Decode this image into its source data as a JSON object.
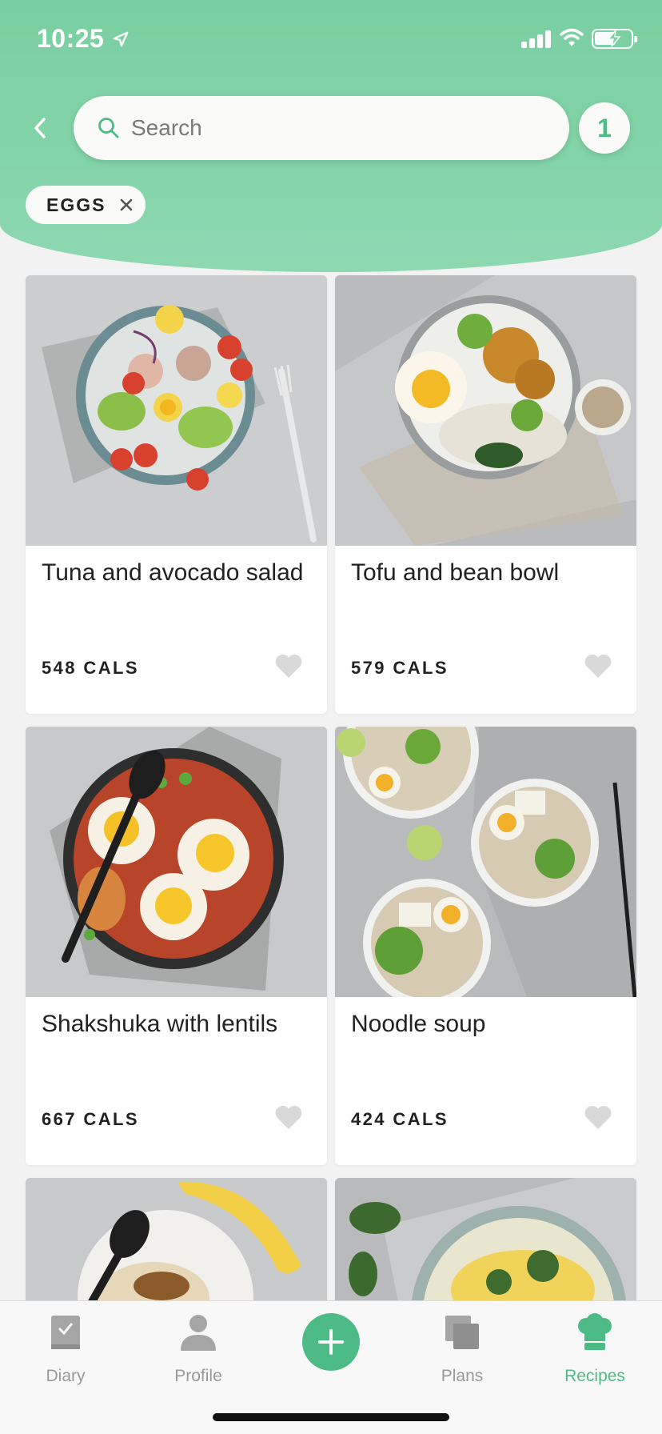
{
  "status": {
    "time": "10:25"
  },
  "search": {
    "placeholder": "Search",
    "value": ""
  },
  "filter_count": "1",
  "filters": [
    {
      "label": "EGGS"
    }
  ],
  "recipes": [
    {
      "title": "Tuna and avocado salad",
      "cals": "548 CALS"
    },
    {
      "title": "Tofu and bean bowl",
      "cals": "579 CALS"
    },
    {
      "title": "Shakshuka with lentils",
      "cals": "667 CALS"
    },
    {
      "title": "Noodle soup",
      "cals": "424 CALS"
    }
  ],
  "tabs": [
    {
      "label": "Diary",
      "icon": "diary-icon"
    },
    {
      "label": "Profile",
      "icon": "profile-icon"
    },
    {
      "label": "Plans",
      "icon": "plans-icon"
    },
    {
      "label": "Recipes",
      "icon": "chef-hat-icon",
      "active": true
    }
  ],
  "colors": {
    "brand": "#4dbb86",
    "header": "#7fd1a5",
    "heart": "#d9d9d9"
  }
}
